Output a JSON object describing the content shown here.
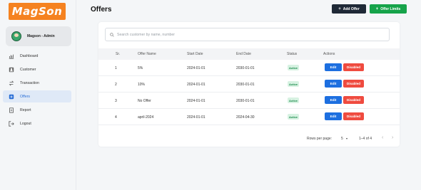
{
  "brand": {
    "logo_text": "MagSon",
    "logo_color": "#f58220"
  },
  "user": {
    "name": "Magson - Admin"
  },
  "sidebar": {
    "items": [
      {
        "label": "Dashboard",
        "icon": "chart-icon"
      },
      {
        "label": "Customer",
        "icon": "person-icon"
      },
      {
        "label": "Transaction",
        "icon": "swap-icon"
      },
      {
        "label": "Offers",
        "icon": "tag-icon",
        "active": true
      },
      {
        "label": "Report",
        "icon": "document-icon"
      },
      {
        "label": "Logout",
        "icon": "logout-icon"
      }
    ]
  },
  "header": {
    "title": "Offers",
    "add_offer_label": "Add Offer",
    "offer_limits_label": "Offer Limits"
  },
  "search": {
    "placeholder": "Search customer by name, number"
  },
  "table": {
    "columns": [
      "Sr.",
      "Offer Name",
      "Start Date",
      "End Date",
      "Status",
      "Actions"
    ],
    "rows": [
      {
        "sr": "1",
        "name": "5%",
        "start": "2024-01-01",
        "end": "2030-01-01",
        "status": "Active",
        "edit": "Edit",
        "disabled": "Disabled"
      },
      {
        "sr": "2",
        "name": "10%",
        "start": "2024-01-01",
        "end": "2030-01-01",
        "status": "Active",
        "edit": "Edit",
        "disabled": "Disabled"
      },
      {
        "sr": "3",
        "name": "No Offer",
        "start": "2024-01-01",
        "end": "2030-01-01",
        "status": "Active",
        "edit": "Edit",
        "disabled": "Disabled"
      },
      {
        "sr": "4",
        "name": "april-2024",
        "start": "2024-01-01",
        "end": "2024-04-30",
        "status": "Active",
        "edit": "Edit",
        "disabled": "Disabled"
      }
    ]
  },
  "pagination": {
    "rows_per_page_label": "Rows per page:",
    "rows_per_page": "5",
    "range": "1–4 of 4"
  },
  "colors": {
    "accent": "#1d6fe0",
    "danger": "#ef4b3f",
    "success": "#16a34a",
    "dark": "#1f2937"
  }
}
